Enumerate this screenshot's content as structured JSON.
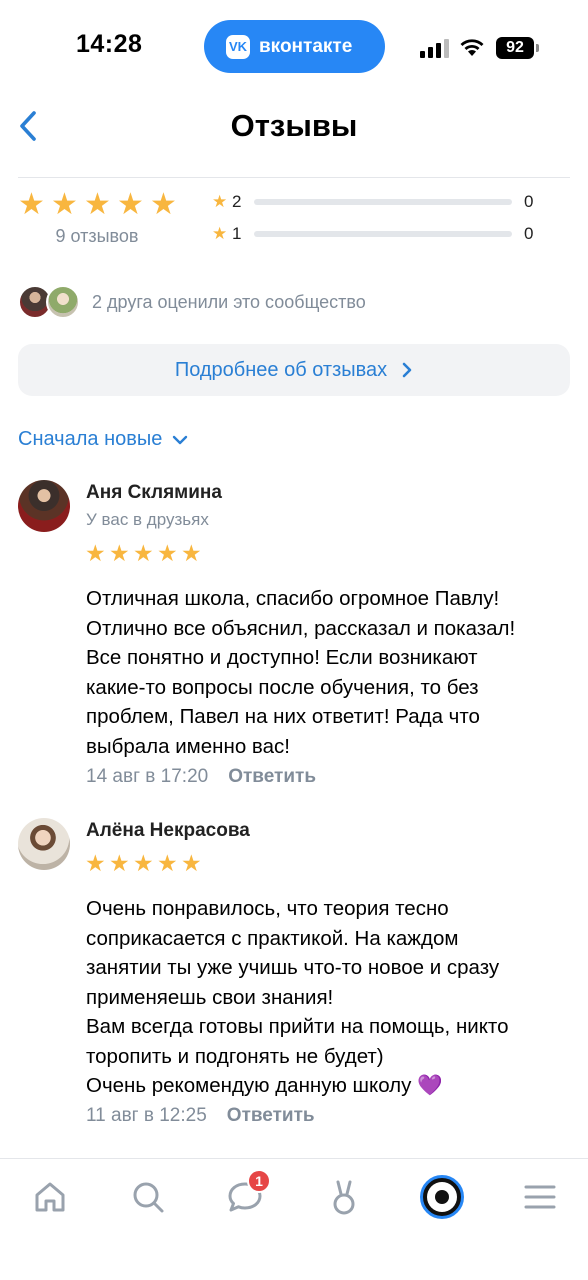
{
  "status_bar": {
    "time": "14:28",
    "app_pill": "вконтакте",
    "app_pill_logo": "VK",
    "battery": "92"
  },
  "header": {
    "title": "Отзывы"
  },
  "summary": {
    "average_rating_stars": 5,
    "reviews_count": "9 отзывов",
    "distribution": [
      {
        "stars": "2",
        "count": "0",
        "fraction": 0
      },
      {
        "stars": "1",
        "count": "0",
        "fraction": 0
      }
    ],
    "friends_text": "2 друга оценили это сообщество",
    "details_button": "Подробнее об отзывах",
    "sort_label": "Сначала новые"
  },
  "reviews": [
    {
      "author": "Аня Склямина",
      "subtitle": "У вас в друзьях",
      "rating": 5,
      "text": "Отличная школа, спасибо огромное Павлу!\nОтлично все объяснил, рассказал и показал!\nВсе понятно и доступно! Если возникают\nкакие-то вопросы после обучения, то без\nпроблем, Павел на них ответит! Рада что\nвыбрала именно вас!",
      "date": "14 авг в 17:20",
      "reply": "Ответить"
    },
    {
      "author": "Алёна Некрасова",
      "rating": 5,
      "text": "Очень понравилось, что теория тесно\nсоприкасается с практикой. На каждом\nзанятии ты уже учишь что-то новое и сразу\nприменяешь свои знания!\nВам всегда готовы прийти на помощь, никто\nторопить и подгонять не будет)\nОчень рекомендую данную школу 💜",
      "date": "11 авг в 12:25",
      "reply": "Ответить"
    }
  ],
  "tabbar": {
    "messages_badge": "1",
    "accent": "#2787f5",
    "icons": [
      "home-icon",
      "search-icon",
      "messages-icon",
      "clips-icon",
      "profile-icon",
      "menu-icon"
    ]
  },
  "colors": {
    "star": "#f8b63f",
    "link": "#2a7fd4",
    "secondary_text": "#818c99"
  }
}
